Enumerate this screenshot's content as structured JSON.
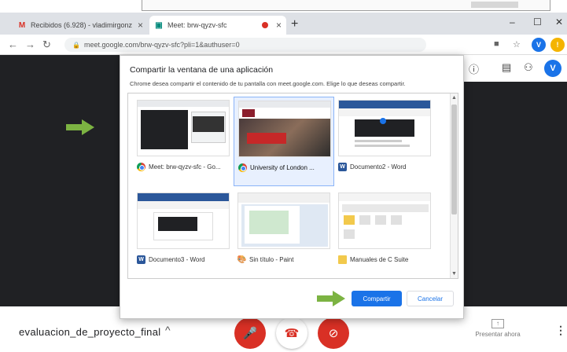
{
  "browser": {
    "tabs": [
      {
        "title": "Recibidos (6.928) - vladimirgonz",
        "favicon": "gmail-icon"
      },
      {
        "title": "Meet: brw-qyzv-sfc",
        "favicon": "meet-icon",
        "recording": true
      }
    ],
    "url": "meet.google.com/brw-qyzv-sfc?pli=1&authuser=0",
    "profile_initial": "V"
  },
  "meet": {
    "meeting_name": "evaluacion_de_proyecto_final",
    "present_label": "Presentar ahora",
    "profile_initial": "V"
  },
  "dialog": {
    "title": "Compartir la ventana de una aplicación",
    "subtitle": "Chrome desea compartir el contenido de tu pantalla con meet.google.com. Elige lo que deseas compartir.",
    "windows": [
      {
        "label": "Meet: brw-qyzv-sfc - Go...",
        "app": "chrome",
        "selected": false
      },
      {
        "label": "University of London ...",
        "app": "chrome",
        "selected": true
      },
      {
        "label": "Documento2 - Word",
        "app": "word",
        "selected": false
      },
      {
        "label": "Documento3 - Word",
        "app": "word",
        "selected": false
      },
      {
        "label": "Sin título - Paint",
        "app": "paint",
        "selected": false
      },
      {
        "label": "Manuales de C Suite",
        "app": "folder",
        "selected": false
      }
    ],
    "share_button": "Compartir",
    "cancel_button": "Cancelar"
  },
  "colors": {
    "accent": "#1a73e8",
    "meet_bg": "#202124",
    "danger": "#d93025",
    "arrow": "#7cb342"
  }
}
